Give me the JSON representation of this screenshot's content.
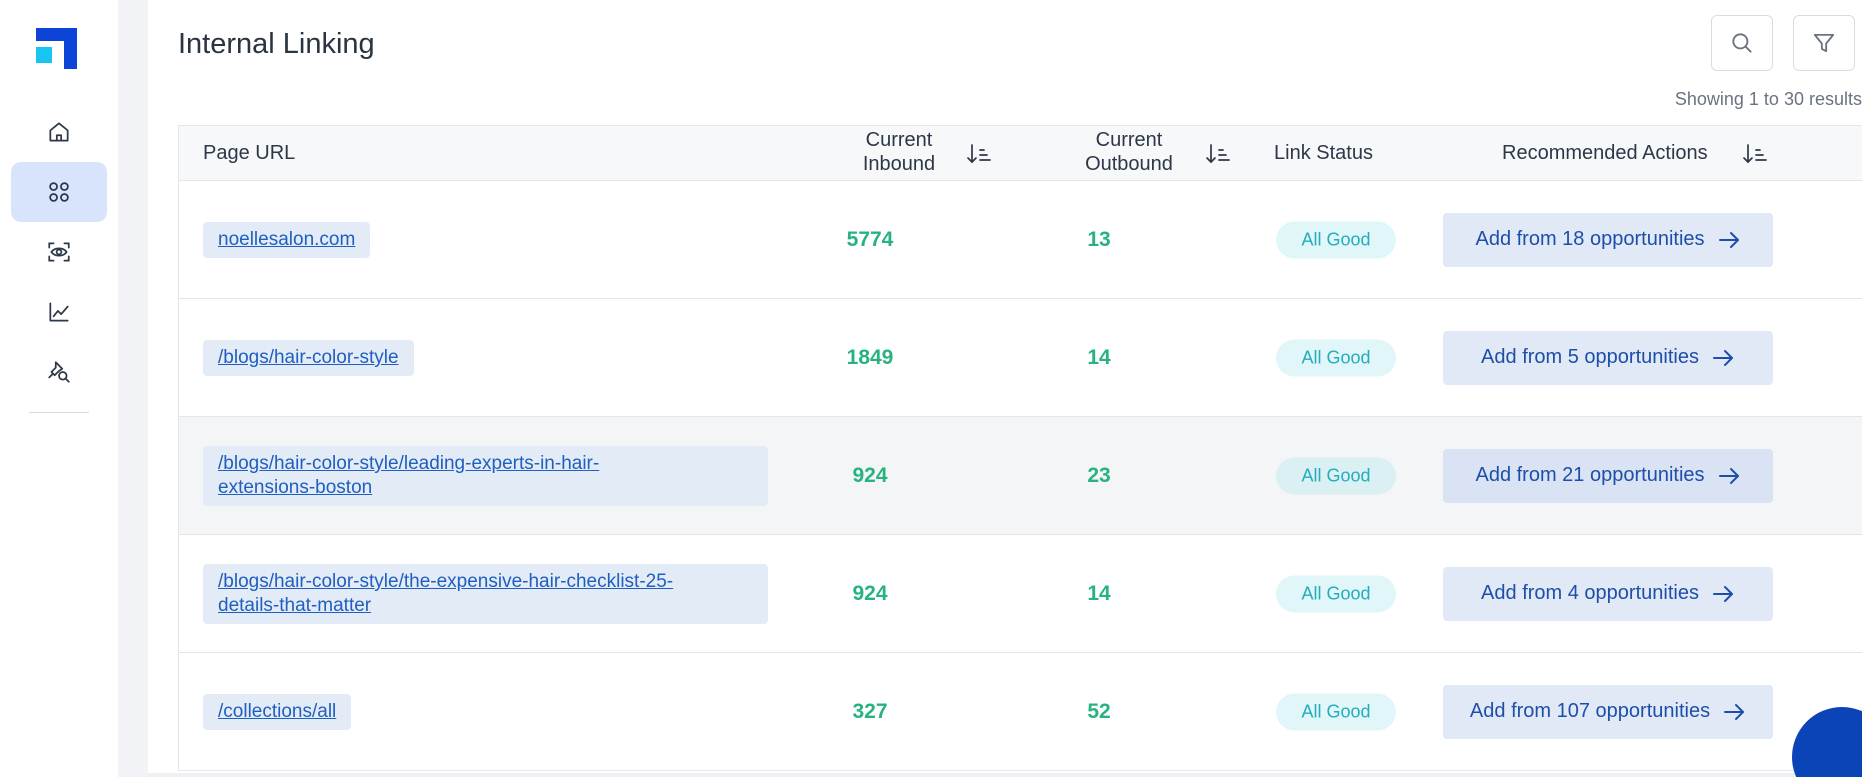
{
  "sidebar": {
    "logo_colors": {
      "primary": "#0b44d6",
      "accent": "#18c5f0"
    },
    "items": [
      {
        "icon": "home-icon",
        "active": false
      },
      {
        "icon": "grid-icon",
        "active": true
      },
      {
        "icon": "eye-scan-icon",
        "active": false
      },
      {
        "icon": "chart-line-icon",
        "active": false
      },
      {
        "icon": "pin-search-icon",
        "active": false
      }
    ]
  },
  "header": {
    "title": "Internal Linking",
    "search_icon": "search-icon",
    "filter_icon": "filter-icon",
    "results_text": "Showing 1 to 30 results"
  },
  "table": {
    "columns": {
      "page_url": "Page URL",
      "current_inbound_line1": "Current",
      "current_inbound_line2": "Inbound",
      "current_outbound_line1": "Current",
      "current_outbound_line2": "Outbound",
      "link_status": "Link Status",
      "recommended_actions": "Recommended Actions"
    },
    "rows": [
      {
        "url_line1": "noellesalon.com",
        "url_line2": "",
        "inbound": "5774",
        "outbound": "13",
        "status": "All Good",
        "action": "Add from 18 opportunities"
      },
      {
        "url_line1": "/blogs/hair-color-style",
        "url_line2": "",
        "inbound": "1849",
        "outbound": "14",
        "status": "All Good",
        "action": "Add from 5 opportunities"
      },
      {
        "url_line1": "/blogs/hair-color-style/leading-experts-in-hair-",
        "url_line2": "extensions-boston",
        "inbound": "924",
        "outbound": "23",
        "status": "All Good",
        "action": "Add from 21 opportunities"
      },
      {
        "url_line1": "/blogs/hair-color-style/the-expensive-hair-checklist-25-",
        "url_line2": "details-that-matter",
        "inbound": "924",
        "outbound": "14",
        "status": "All Good",
        "action": "Add from 4 opportunities"
      },
      {
        "url_line1": "/collections/all",
        "url_line2": "",
        "inbound": "327",
        "outbound": "52",
        "status": "All Good",
        "action": "Add from 107 opportunities"
      }
    ]
  },
  "colors": {
    "accent_blue": "#1d4fa9",
    "number_green": "#27b37f",
    "status_teal": "#23aebd",
    "active_nav_bg": "#d7e4fb"
  }
}
